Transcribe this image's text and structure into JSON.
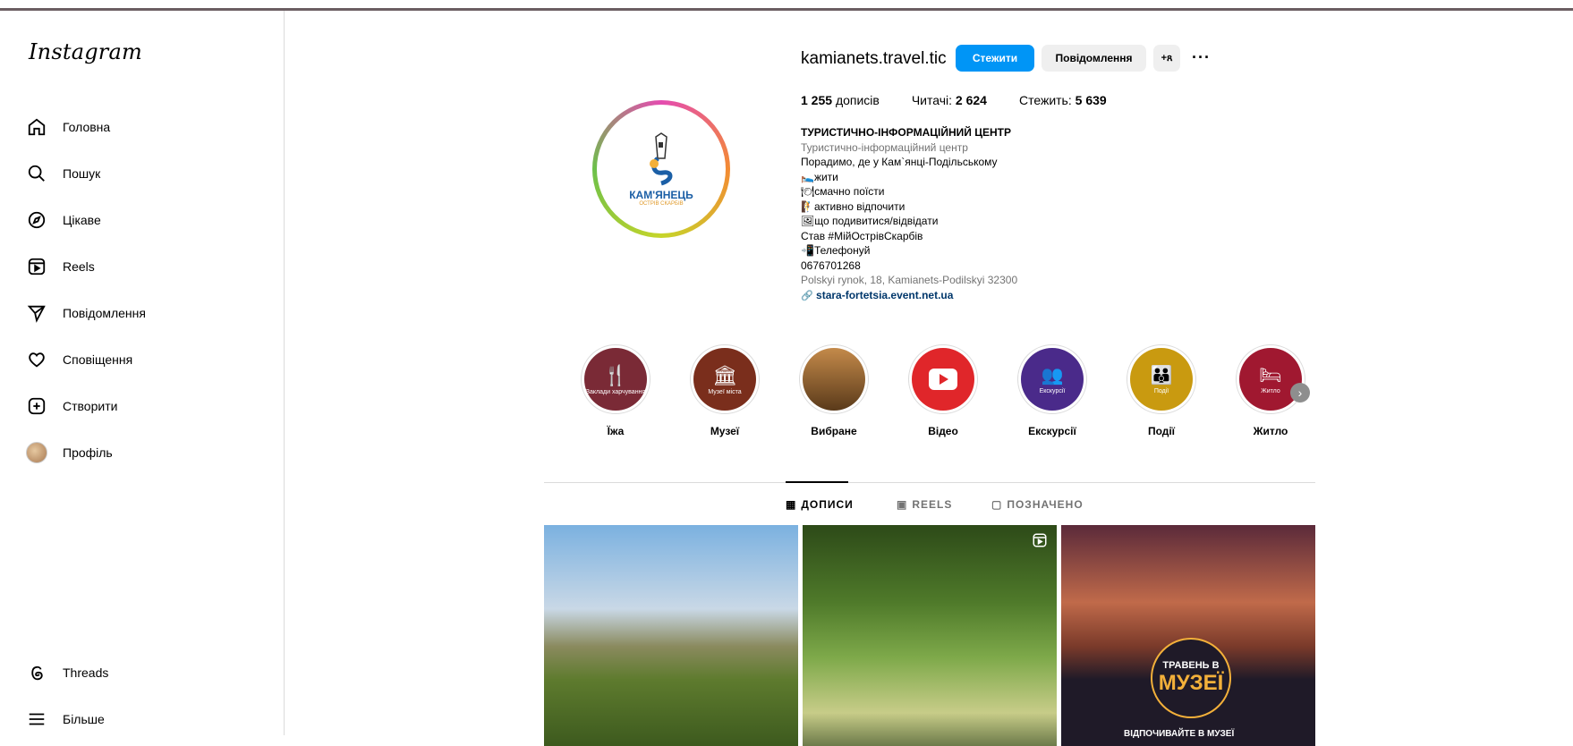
{
  "sidebar": {
    "logo": "Instagram",
    "items": [
      {
        "label": "Головна",
        "icon": "home-icon"
      },
      {
        "label": "Пошук",
        "icon": "search-icon"
      },
      {
        "label": "Цікаве",
        "icon": "compass-icon"
      },
      {
        "label": "Reels",
        "icon": "reels-icon"
      },
      {
        "label": "Повідомлення",
        "icon": "send-icon"
      },
      {
        "label": "Сповіщення",
        "icon": "heart-icon"
      },
      {
        "label": "Створити",
        "icon": "plus-square-icon"
      },
      {
        "label": "Профіль",
        "icon": "avatar"
      }
    ],
    "bottom": [
      {
        "label": "Threads",
        "icon": "threads-icon"
      },
      {
        "label": "Більше",
        "icon": "menu-icon"
      }
    ]
  },
  "profile": {
    "username": "kamianets.travel.tic",
    "follow_label": "Стежити",
    "message_label": "Повідомлення",
    "suggest_label": "+ጸ",
    "more_label": "···",
    "avatar_text": "КАМ'ЯНЕЦЬ",
    "avatar_subtext": "ОСТРІВ СКАРБІВ",
    "stats": {
      "posts_count": "1 255",
      "posts_label": "дописів",
      "followers_label": "Читачі:",
      "followers_count": "2 624",
      "following_label": "Стежить:",
      "following_count": "5 639"
    },
    "bio": {
      "name": "ТУРИСТИЧНО-ІНФОРМАЦІЙНИЙ ЦЕНТР",
      "category": "Туристично-інформаційний центр",
      "lines": [
        "Порадимо, де у Кам`янці-Подільському",
        "🛌жити",
        "🍽смачно поїсти",
        "🧗активно відпочити",
        "🖼що подивитися/відвідати",
        "Став #МійОстрівСкарбів",
        "📲Телефонуй",
        "0676701268"
      ],
      "address": "Polskyi rynok, 18, Kamianets-Podilskyi 32300",
      "link": "stara-fortetsia.event.net.ua"
    }
  },
  "highlights": [
    {
      "name": "Їжа",
      "inner": "Заклади харчування",
      "color": "#7a2a36",
      "symbol": "🍴"
    },
    {
      "name": "Музеї",
      "inner": "Музеї міста",
      "color": "#7a2e1c",
      "symbol": "🏛"
    },
    {
      "name": "Вибране",
      "inner": "",
      "color": "#9a6a3a",
      "symbol": ""
    },
    {
      "name": "Відео",
      "inner": "",
      "color": "#e0262a",
      "symbol": "▶"
    },
    {
      "name": "Екскурсії",
      "inner": "Екскурсії",
      "color": "#4a2a8a",
      "symbol": "👥"
    },
    {
      "name": "Події",
      "inner": "Події",
      "color": "#c99a10",
      "symbol": "👪"
    },
    {
      "name": "Житло",
      "inner": "Житло",
      "color": "#a01830",
      "symbol": "🛏"
    }
  ],
  "tabs": [
    {
      "label": "ДОПИСИ",
      "icon": "grid-icon"
    },
    {
      "label": "REELS",
      "icon": "reels-icon"
    },
    {
      "label": "ПОЗНАЧЕНО",
      "icon": "tagged-icon"
    }
  ],
  "posts": {
    "post3_line1": "ТРАВЕНЬ В",
    "post3_line2": "МУЗЕЇ",
    "post3_line3": "ВІДПОЧИВАЙТЕ В МУЗЕЇ"
  }
}
